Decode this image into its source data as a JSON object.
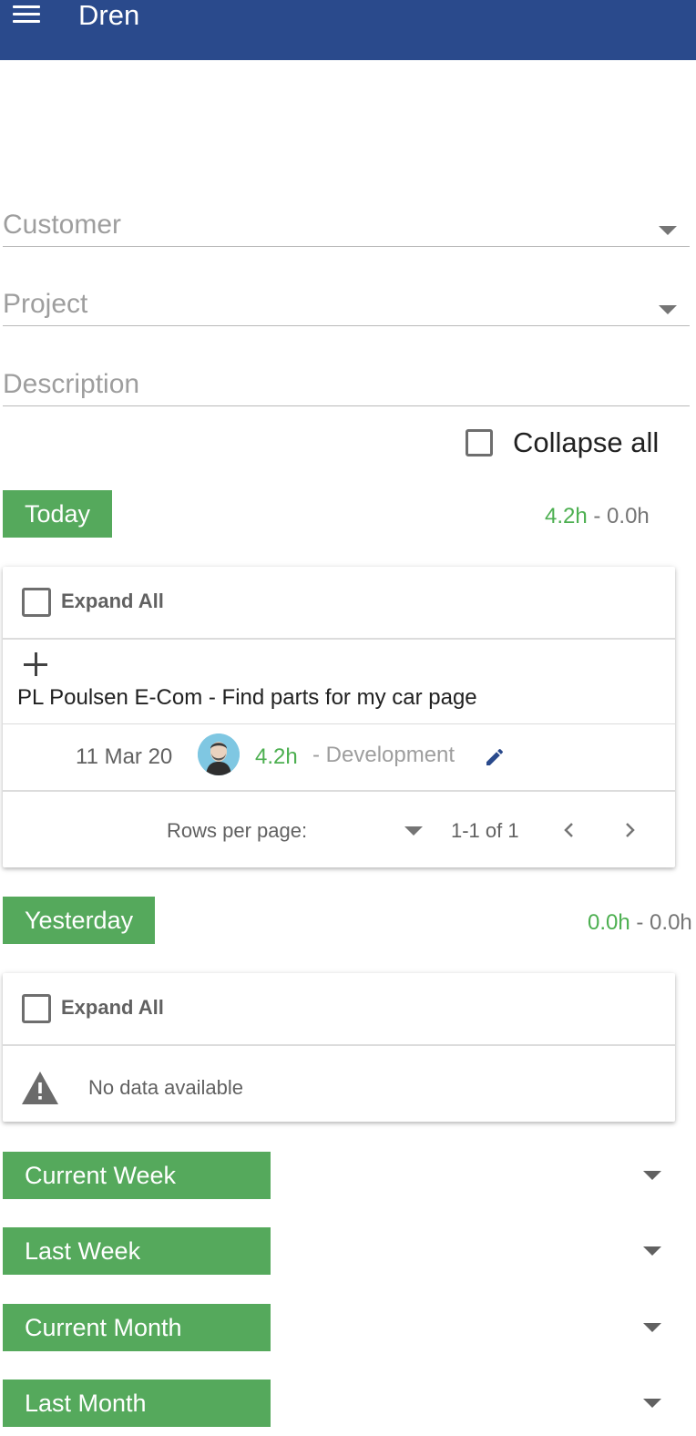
{
  "appbar": {
    "title": "Dren",
    "menu_icon": "menu-icon"
  },
  "filters": {
    "customer_label": "Customer",
    "project_label": "Project",
    "description_label": "Description",
    "collapse_all_label": "Collapse all"
  },
  "today": {
    "label": "Today",
    "hours_tracked": "4.2h",
    "hours_separator": " - ",
    "hours_other": "0.0h",
    "expand_all_label": "Expand All",
    "group_title": "PL Poulsen E-Com - Find parts for my car page",
    "entry": {
      "date": "11 Mar 20",
      "hours": "4.2h",
      "type": "- Development"
    },
    "pager": {
      "rows_per_page_label": "Rows per page:",
      "range": "1-1 of 1"
    }
  },
  "yesterday": {
    "label": "Yesterday",
    "hours_tracked": "0.0h",
    "hours_separator": " - ",
    "hours_other": "0.0h",
    "expand_all_label": "Expand All",
    "no_data": "No data available"
  },
  "periods": [
    {
      "label": "Current Week"
    },
    {
      "label": "Last Week"
    },
    {
      "label": "Current Month"
    },
    {
      "label": "Last Month"
    }
  ],
  "colors": {
    "appbar": "#2a4a8c",
    "accent_green": "#55a95c",
    "hours_green": "#4caf50",
    "edit_blue": "#2a4a8c"
  }
}
